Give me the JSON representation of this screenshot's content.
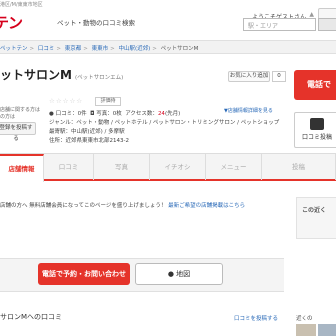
{
  "header": {
    "tag": "港区/M/東東市地区",
    "logo": "テン",
    "tagline": "ペット・動物の口コミ検索",
    "welcome": "ようこそゲストさん",
    "welcome_arrow": "▲",
    "search_placeholder": "駅・エリア"
  },
  "breadcrumb": {
    "items": [
      "ペットテン",
      "口コミ",
      "東京都",
      "東東市",
      "中山駅(近郊)"
    ],
    "current": "ペットサロンM",
    "separator": ">"
  },
  "shop": {
    "name": "ットサロンM",
    "reading": "(ペットサロンエム)",
    "fav_button": "お気に入り追加",
    "fav_count": "0",
    "call_button": "電話で",
    "stars": "☆☆☆☆☆",
    "rating": "評価待",
    "kuchikomi_link": "▼店舗情報詳細を見る",
    "stats": {
      "reviews_label": "口コミ：",
      "reviews_value": "0件",
      "photos_label": "写真：",
      "photos_value": "0枚",
      "access_label": "アクセス数：",
      "access_value": "24",
      "access_unit": "(先月)"
    },
    "genre": "ジャンル：ペット・動物 / ペットホテル / ペットサロン・トリミングサロン / ペットショップ",
    "station": "最寄駅：中山駅(近郊) / 多摩駅",
    "address": "住所：近郊県東東市北部2143-2",
    "left_note1": "店舗に関する方は",
    "left_note2": "の方は",
    "left_button": "登録を投稿する",
    "right_button": "口コミ投稿"
  },
  "tabs": [
    {
      "label": "店舗情報",
      "active": true
    },
    {
      "label": "口コミ",
      "active": false
    },
    {
      "label": "写真",
      "active": false
    },
    {
      "label": "イチオシ",
      "active": false
    },
    {
      "label": "メニュー",
      "active": false
    },
    {
      "label": "投稿",
      "active": false
    }
  ],
  "notice": {
    "text": "店舗の方へ 無料店舗会員になってこのページを盛り上げましょう！",
    "link": "最新ご希望の店舗掲載はこちら"
  },
  "side_box_title": "この近く",
  "actions": {
    "reserve": "電話で予約・お問い合わせ",
    "map": "地図"
  },
  "reviews": {
    "heading": "サロンMへの口コミ",
    "post_link": "口コミを投稿する",
    "side_label": "近くの"
  }
}
